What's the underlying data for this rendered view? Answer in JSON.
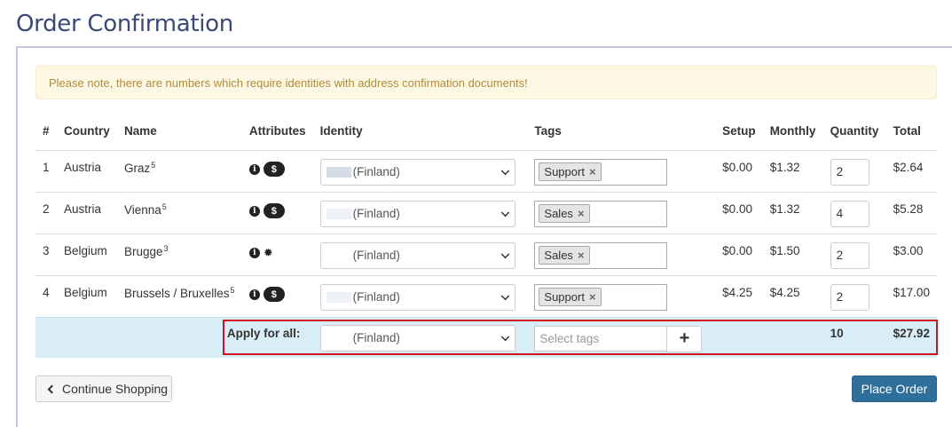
{
  "page": {
    "title": "Order Confirmation"
  },
  "alert": {
    "text": "Please note, there are numbers which require identities with address confirmation documents!"
  },
  "table": {
    "headers": {
      "num": "#",
      "country": "Country",
      "name": "Name",
      "attributes": "Attributes",
      "identity": "Identity",
      "tags": "Tags",
      "setup": "Setup",
      "monthly": "Monthly",
      "quantity": "Quantity",
      "total": "Total"
    },
    "rows": [
      {
        "num": "1",
        "country": "Austria",
        "name": "Graz",
        "sup": "5",
        "attr": [
          "info-icon",
          "dollar-badge"
        ],
        "identity": "(Finland)",
        "tag": "Support",
        "setup": "$0.00",
        "monthly": "$1.32",
        "qty": "2",
        "total": "$2.64"
      },
      {
        "num": "2",
        "country": "Austria",
        "name": "Vienna",
        "sup": "5",
        "attr": [
          "info-icon",
          "dollar-badge"
        ],
        "identity": "(Finland)",
        "tag": "Sales",
        "setup": "$0.00",
        "monthly": "$1.32",
        "qty": "4",
        "total": "$5.28"
      },
      {
        "num": "3",
        "country": "Belgium",
        "name": "Brugge",
        "sup": "3",
        "attr": [
          "info-icon",
          "star-icon"
        ],
        "identity": "(Finland)",
        "tag": "Sales",
        "setup": "$0.00",
        "monthly": "$1.50",
        "qty": "2",
        "total": "$3.00"
      },
      {
        "num": "4",
        "country": "Belgium",
        "name": "Brussels / Bruxelles",
        "sup": "5",
        "attr": [
          "info-icon",
          "dollar-badge"
        ],
        "identity": "(Finland)",
        "tag": "Support",
        "setup": "$4.25",
        "monthly": "$4.25",
        "qty": "2",
        "total": "$17.00"
      }
    ],
    "apply": {
      "label": "Apply for all:",
      "identity": "(Finland)",
      "tags_placeholder": "Select tags",
      "plus": "+",
      "quantity_total": "10",
      "grand_total": "$27.92"
    }
  },
  "buttons": {
    "continue": "Continue Shopping",
    "place_order": "Place Order"
  },
  "colors": {
    "title": "#3a4a75",
    "alert_bg": "#fcf8e3",
    "alert_text": "#b08a3e",
    "apply_row_bg": "#d9edf7",
    "highlight": "#d0131f",
    "primary": "#2f6f9c"
  }
}
